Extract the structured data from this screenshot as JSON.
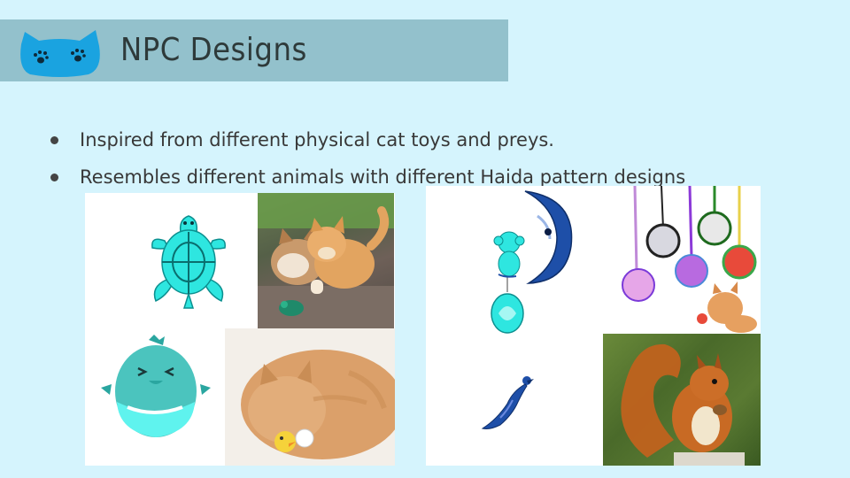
{
  "slide": {
    "title": "NPC Designs",
    "bullets": [
      "Inspired from different physical cat toys and preys.",
      "Resembles different animals with different Haida pattern designs"
    ]
  },
  "colors": {
    "background": "#d5f4fd",
    "header_bar": "#93c1cc",
    "logo_blue": "#1aa3e0",
    "haida_teal": "#2ee6e0",
    "haida_blue": "#1e4fa8"
  },
  "images": [
    {
      "name": "haida-turtle-icon"
    },
    {
      "name": "kittens-photo"
    },
    {
      "name": "haida-bird-icon"
    },
    {
      "name": "orange-cat-with-toy-photo"
    },
    {
      "name": "haida-moon-monkey-icon"
    },
    {
      "name": "yarn-ball-toys-photo"
    },
    {
      "name": "haida-peacock-icon"
    },
    {
      "name": "red-squirrel-photo"
    }
  ]
}
